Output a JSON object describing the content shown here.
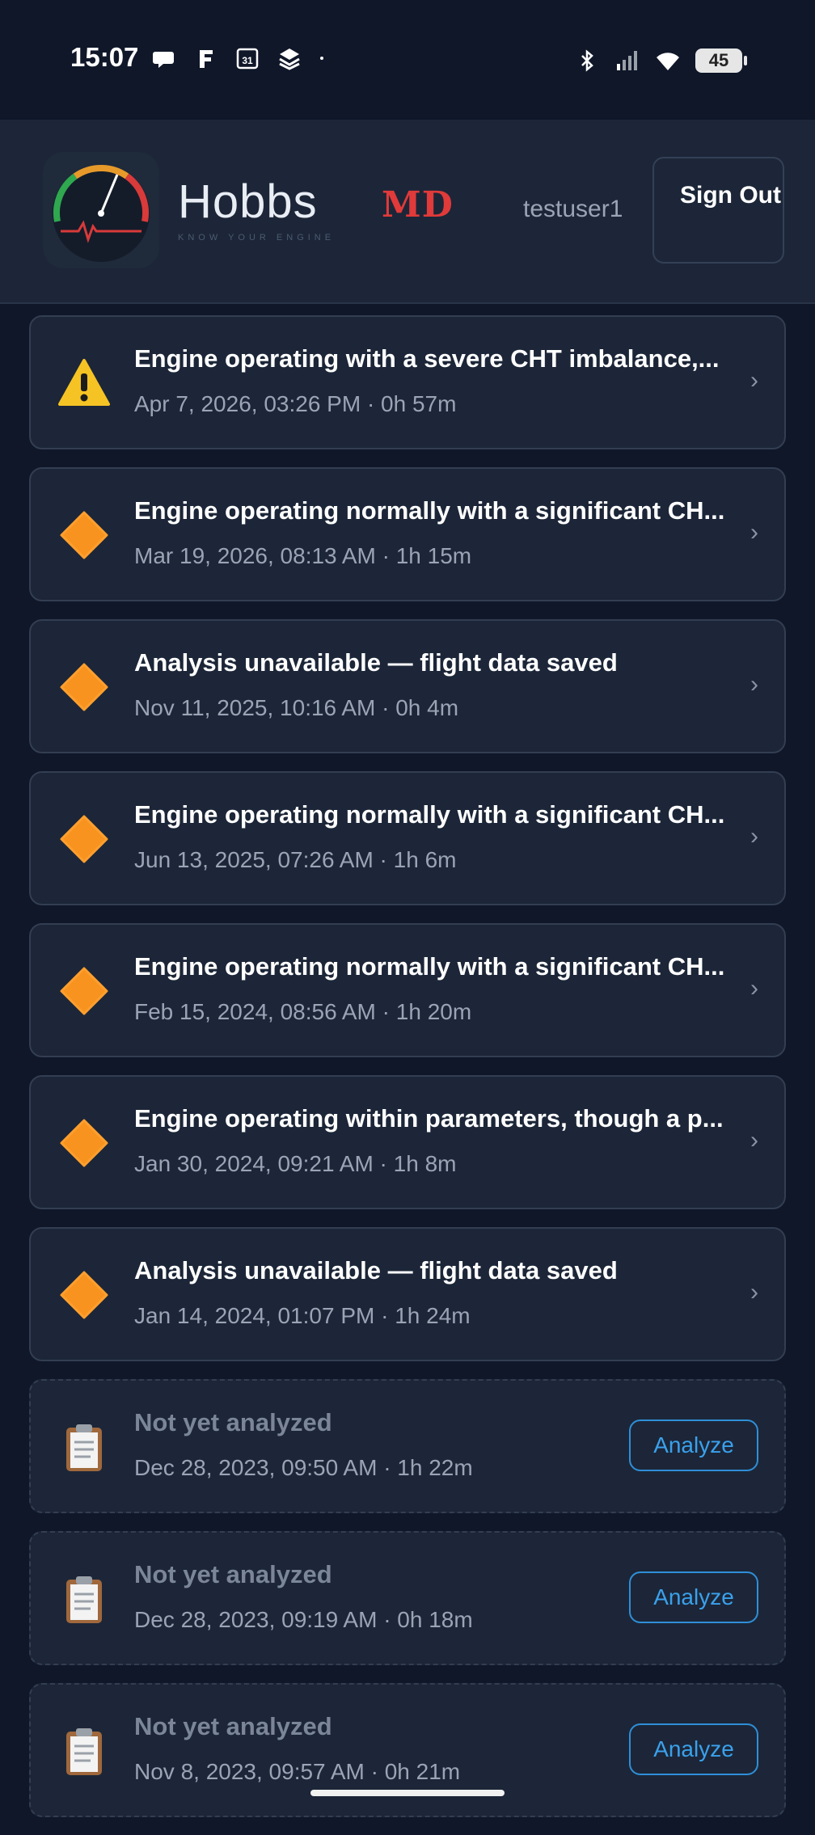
{
  "status_bar": {
    "time": "15:07",
    "left_icons": [
      "chat-bubble-icon",
      "f-app-icon",
      "calendar-31-icon",
      "layers-app-icon",
      "dot-icon"
    ],
    "calendar_text": "31",
    "right_icons": [
      "bluetooth-icon",
      "signal-icon",
      "wifi-icon"
    ],
    "battery": "45"
  },
  "header": {
    "brand_name": "Hobbs",
    "brand_tagline": "KNOW YOUR ENGINE",
    "md_badge": "MD",
    "username": "testuser1",
    "sign_out": "Sign Out",
    "colors": {
      "md": "#e03a3a",
      "accent": "#3aa1ec"
    }
  },
  "flights": [
    {
      "icon": "warning-icon",
      "title": "Engine operating with a severe CHT imbalance,...",
      "date": "Apr 7, 2026, 03:26 PM",
      "duration": "0h 57m",
      "subtitle": "Apr 7, 2026, 03:26 PM · 0h 57m",
      "status": "analyzed"
    },
    {
      "icon": "orange-diamond-icon",
      "title": "Engine operating normally with a significant CH...",
      "subtitle": "Mar 19, 2026, 08:13 AM · 1h 15m",
      "status": "analyzed"
    },
    {
      "icon": "orange-diamond-icon",
      "title": "Analysis unavailable — flight data saved",
      "subtitle": "Nov 11, 2025, 10:16 AM · 0h 4m",
      "status": "analyzed"
    },
    {
      "icon": "orange-diamond-icon",
      "title": "Engine operating normally with a significant CH...",
      "subtitle": "Jun 13, 2025, 07:26 AM · 1h 6m",
      "status": "analyzed"
    },
    {
      "icon": "orange-diamond-icon",
      "title": "Engine operating normally with a significant CH...",
      "subtitle": "Feb 15, 2024, 08:56 AM · 1h 20m",
      "status": "analyzed"
    },
    {
      "icon": "orange-diamond-icon",
      "title": "Engine operating within parameters, though a p...",
      "subtitle": "Jan 30, 2024, 09:21 AM · 1h 8m",
      "status": "analyzed"
    },
    {
      "icon": "orange-diamond-icon",
      "title": "Analysis unavailable — flight data saved",
      "subtitle": "Jan 14, 2024, 01:07 PM · 1h 24m",
      "status": "analyzed"
    },
    {
      "icon": "clipboard-icon",
      "title": "Not yet analyzed",
      "subtitle": "Dec 28, 2023, 09:50 AM · 1h 22m",
      "status": "pending",
      "action": "Analyze"
    },
    {
      "icon": "clipboard-icon",
      "title": "Not yet analyzed",
      "subtitle": "Dec 28, 2023, 09:19 AM · 0h 18m",
      "status": "pending",
      "action": "Analyze"
    },
    {
      "icon": "clipboard-icon",
      "title": "Not yet analyzed",
      "subtitle": "Nov 8, 2023, 09:57 AM · 0h 21m",
      "status": "pending",
      "action": "Analyze"
    }
  ],
  "chevron": "›"
}
